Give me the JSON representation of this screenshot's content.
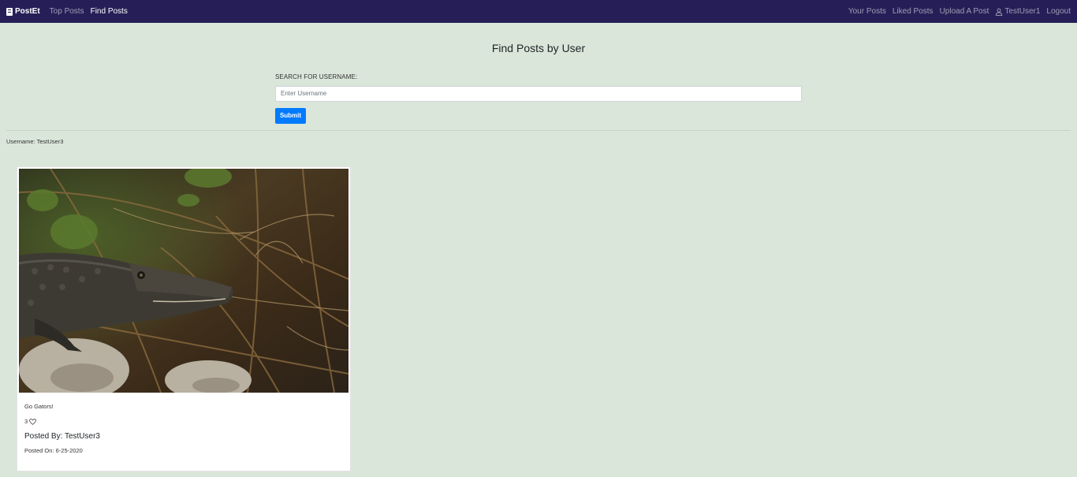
{
  "nav": {
    "brand": "PostEt",
    "left_links": [
      {
        "label": "Top Posts",
        "active": false
      },
      {
        "label": "Find Posts",
        "active": true
      }
    ],
    "right_links": {
      "your_posts": "Your Posts",
      "liked_posts": "Liked Posts",
      "upload": "Upload A Post",
      "user": "TestUser1",
      "logout": "Logout"
    }
  },
  "page": {
    "title": "Find Posts by User"
  },
  "search": {
    "label": "SEARCH FOR USERNAME:",
    "placeholder": "Enter Username",
    "value": "",
    "submit_label": "Submit"
  },
  "result": {
    "username_line": "Username: TestUser3"
  },
  "post": {
    "caption": "Go Gators!",
    "likes": "3",
    "posted_by": "Posted By: TestUser3",
    "posted_on": "Posted On: 6-25-2020"
  },
  "colors": {
    "navbar": "#261f57",
    "background": "#dae6d9",
    "primary": "#007bff"
  }
}
